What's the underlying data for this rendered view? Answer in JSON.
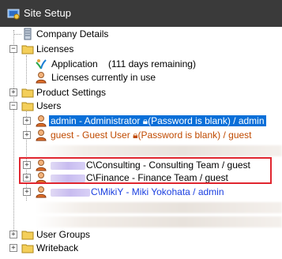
{
  "window": {
    "title": "Site Setup",
    "icon": "site-setup-icon"
  },
  "tree": {
    "company_details": "Company Details",
    "licenses": "Licenses",
    "application": "Application",
    "application_remaining": "(111 days remaining)",
    "licenses_in_use": "Licenses currently in use",
    "product_settings": "Product Settings",
    "users": "Users",
    "user_admin": "admin - Administrator",
    "user_admin_note": "(Password is blank) / admin",
    "user_guest": "guest - Guest User",
    "user_guest_note": "(Password is blank) / guest",
    "user_consulting": "C\\Consulting - Consulting Team / guest",
    "user_finance": "C\\Finance - Finance Team / guest",
    "user_miki": "C\\MikiY - Miki Yokohata / admin",
    "user_groups": "User Groups",
    "writeback": "Writeback"
  },
  "colors": {
    "titlebar": "#3a3a3a",
    "selection": "#0a6fd8",
    "highlight_box": "#e0262f",
    "miki_text": "#1a3fe0",
    "guest_text": "#c04a00"
  }
}
